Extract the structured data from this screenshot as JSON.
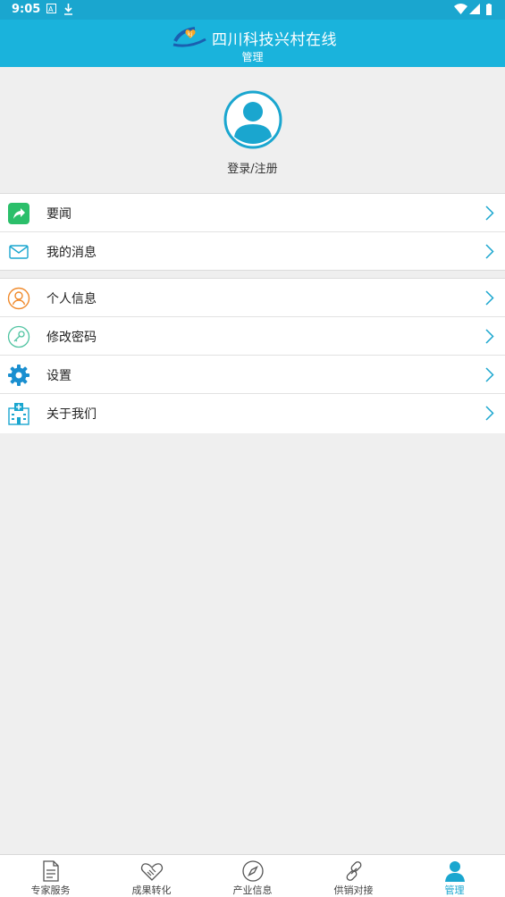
{
  "status_bar": {
    "time": "9:05"
  },
  "header": {
    "app_title": "四川科技兴村在线",
    "subtitle": "管理"
  },
  "profile": {
    "login_label": "登录/注册"
  },
  "menu_group1": [
    {
      "label": "要闻",
      "icon": "share-icon"
    },
    {
      "label": "我的消息",
      "icon": "mail-icon"
    }
  ],
  "menu_group2": [
    {
      "label": "个人信息",
      "icon": "user-circle-icon"
    },
    {
      "label": "修改密码",
      "icon": "key-icon"
    },
    {
      "label": "设置",
      "icon": "gear-icon"
    },
    {
      "label": "关于我们",
      "icon": "hospital-icon"
    }
  ],
  "tabs": [
    {
      "label": "专家服务",
      "icon": "document-icon"
    },
    {
      "label": "成果转化",
      "icon": "handshake-icon"
    },
    {
      "label": "产业信息",
      "icon": "compass-icon"
    },
    {
      "label": "供销对接",
      "icon": "link-icon"
    },
    {
      "label": "管理",
      "icon": "person-icon",
      "active": true
    }
  ],
  "colors": {
    "primary": "#1ab3dc",
    "accent": "#1aa6cf",
    "share_green": "#2bbf6a",
    "gear_blue": "#1a8fd0",
    "user_orange": "#f08a2c"
  }
}
